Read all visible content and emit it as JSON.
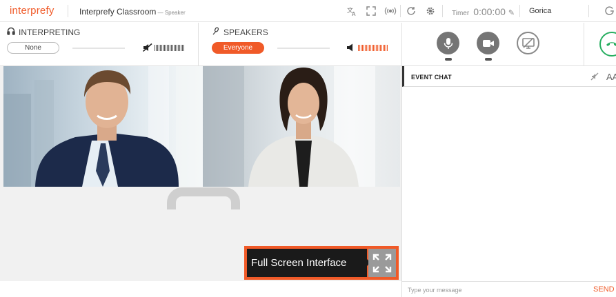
{
  "app": {
    "logo": "interprefy",
    "classroom_title": "Interprefy Classroom",
    "role": " — Speaker",
    "timer_label": "Timer",
    "timer_value": "0:00:00",
    "username": "Gorica"
  },
  "interpreting": {
    "title": "INTERPRETING",
    "selected": "None"
  },
  "speakers": {
    "title": "SPEAKERS",
    "selected": "Everyone"
  },
  "video": {
    "fullscreen_label": "Full Screen Interface"
  },
  "chat": {
    "title": "EVENT CHAT",
    "font_icon_text": "AA",
    "input_placeholder": "Type your message",
    "send_label": "SEND"
  },
  "colors": {
    "brand": "#f05a28",
    "hangup": "#27ae60",
    "media_button": "#757575"
  },
  "icons": {
    "interpreting": "headphones-icon",
    "speakers": "microphone-icon",
    "mute_interpreting": "muted-speaker-icon",
    "speakers_volume": "speaker-icon",
    "mic": "microphone-icon",
    "camera": "video-camera-icon",
    "screen_share": "screen-share-off-icon",
    "hangup": "phone-hangup-icon",
    "fullscreen": "expand-icon"
  }
}
